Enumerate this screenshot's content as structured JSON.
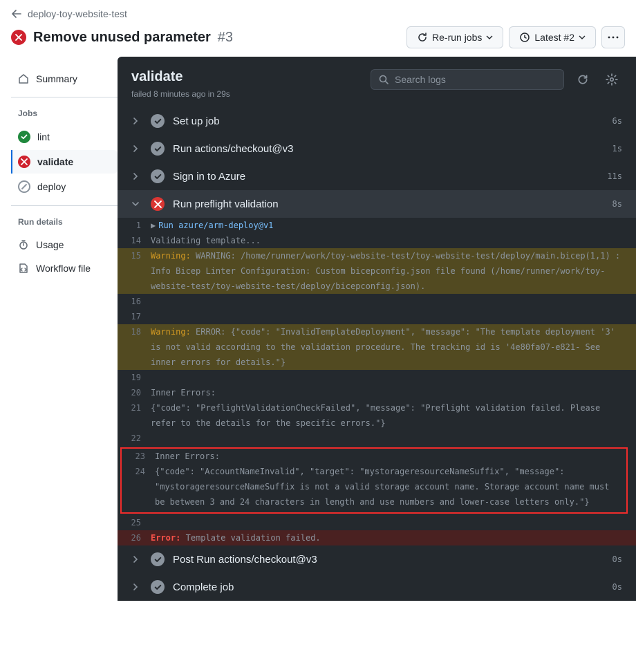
{
  "breadcrumb": "deploy-toy-website-test",
  "title": "Remove unused parameter",
  "title_num": "#3",
  "header_buttons": {
    "rerun": "Re-run jobs",
    "latest": "Latest #2"
  },
  "sidebar": {
    "summary": "Summary",
    "jobs_heading": "Jobs",
    "run_details_heading": "Run details",
    "jobs": [
      {
        "label": "lint",
        "status": "success"
      },
      {
        "label": "validate",
        "status": "failure",
        "selected": true
      },
      {
        "label": "deploy",
        "status": "skipped"
      }
    ],
    "usage": "Usage",
    "workflow_file": "Workflow file"
  },
  "job": {
    "name": "validate",
    "subtitle": "failed 8 minutes ago in 29s"
  },
  "search": {
    "placeholder": "Search logs"
  },
  "steps": [
    {
      "label": "Set up job",
      "status": "success",
      "dur": "6s",
      "open": false
    },
    {
      "label": "Run actions/checkout@v3",
      "status": "success",
      "dur": "1s",
      "open": false
    },
    {
      "label": "Sign in to Azure",
      "status": "success",
      "dur": "11s",
      "open": false
    },
    {
      "label": "Run preflight validation",
      "status": "failure",
      "dur": "8s",
      "open": true
    },
    {
      "label": "Post Run actions/checkout@v3",
      "status": "success",
      "dur": "0s",
      "open": false
    },
    {
      "label": "Complete job",
      "status": "success",
      "dur": "0s",
      "open": false
    }
  ],
  "logs": [
    {
      "n": "1",
      "kind": "cmd",
      "text": "Run azure/arm-deploy@v1"
    },
    {
      "n": "14",
      "kind": "plain",
      "text": "Validating template..."
    },
    {
      "n": "15",
      "kind": "warn",
      "prefix": "Warning: ",
      "text": "WARNING: /home/runner/work/toy-website-test/toy-website-test/deploy/main.bicep(1,1) : Info Bicep Linter Configuration: Custom bicepconfig.json file found (/home/runner/work/toy-website-test/toy-website-test/deploy/bicepconfig.json)."
    },
    {
      "n": "16",
      "kind": "plain",
      "text": ""
    },
    {
      "n": "17",
      "kind": "plain",
      "text": ""
    },
    {
      "n": "18",
      "kind": "warn",
      "prefix": "Warning: ",
      "text": "ERROR: {\"code\": \"InvalidTemplateDeployment\", \"message\": \"The template deployment '3' is not valid according to the validation procedure. The tracking id is '4e80fa07-e821- See inner errors for details.\"}"
    },
    {
      "n": "19",
      "kind": "plain",
      "text": ""
    },
    {
      "n": "20",
      "kind": "plain",
      "text": "Inner Errors:"
    },
    {
      "n": "21",
      "kind": "plain",
      "text": "{\"code\": \"PreflightValidationCheckFailed\", \"message\": \"Preflight validation failed. Please refer to the details for the specific errors.\"}"
    },
    {
      "n": "22",
      "kind": "plain",
      "text": ""
    },
    {
      "n": "23",
      "kind": "plain",
      "text": "Inner Errors:",
      "boxed": true
    },
    {
      "n": "24",
      "kind": "plain",
      "text": "{\"code\": \"AccountNameInvalid\", \"target\": \"mystorageresourceNameSuffix\", \"message\": \"mystorageresourceNameSuffix is not a valid storage account name. Storage account name must be between 3 and 24 characters in length and use numbers and lower-case letters only.\"}",
      "boxed": true
    },
    {
      "n": "25",
      "kind": "plain",
      "text": ""
    },
    {
      "n": "26",
      "kind": "error",
      "prefix": "Error: ",
      "text": "Template validation failed."
    }
  ]
}
